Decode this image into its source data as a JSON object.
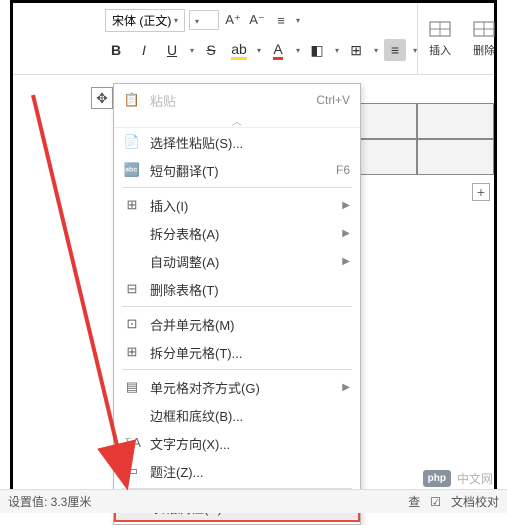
{
  "ribbon": {
    "font_name": "宋体 (正文)",
    "aplus": "A⁺",
    "aminus": "A⁻",
    "bold": "B",
    "italic": "I",
    "underline": "U",
    "strike": "S",
    "insert_label": "插入",
    "delete_label": "删除"
  },
  "menu": {
    "paste_faded": "粘贴",
    "paste_shortcut": "Ctrl+V",
    "paste_special": "选择性粘贴(S)...",
    "translate": "短句翻译(T)",
    "translate_key": "F6",
    "insert": "插入(I)",
    "split_table": "拆分表格(A)",
    "auto_fit": "自动调整(A)",
    "delete_table": "删除表格(T)",
    "merge_cells": "合并单元格(M)",
    "split_cells": "拆分单元格(T)...",
    "cell_align": "单元格对齐方式(G)",
    "borders": "边框和底纹(B)...",
    "text_dir": "文字方向(X)...",
    "caption": "题注(Z)...",
    "table_props": "表格属性(R)..."
  },
  "status": {
    "left": "设置值: 3.3厘米",
    "check": "查",
    "proof": "文档校对"
  },
  "watermark": {
    "logo": "php",
    "text": "中文网"
  }
}
